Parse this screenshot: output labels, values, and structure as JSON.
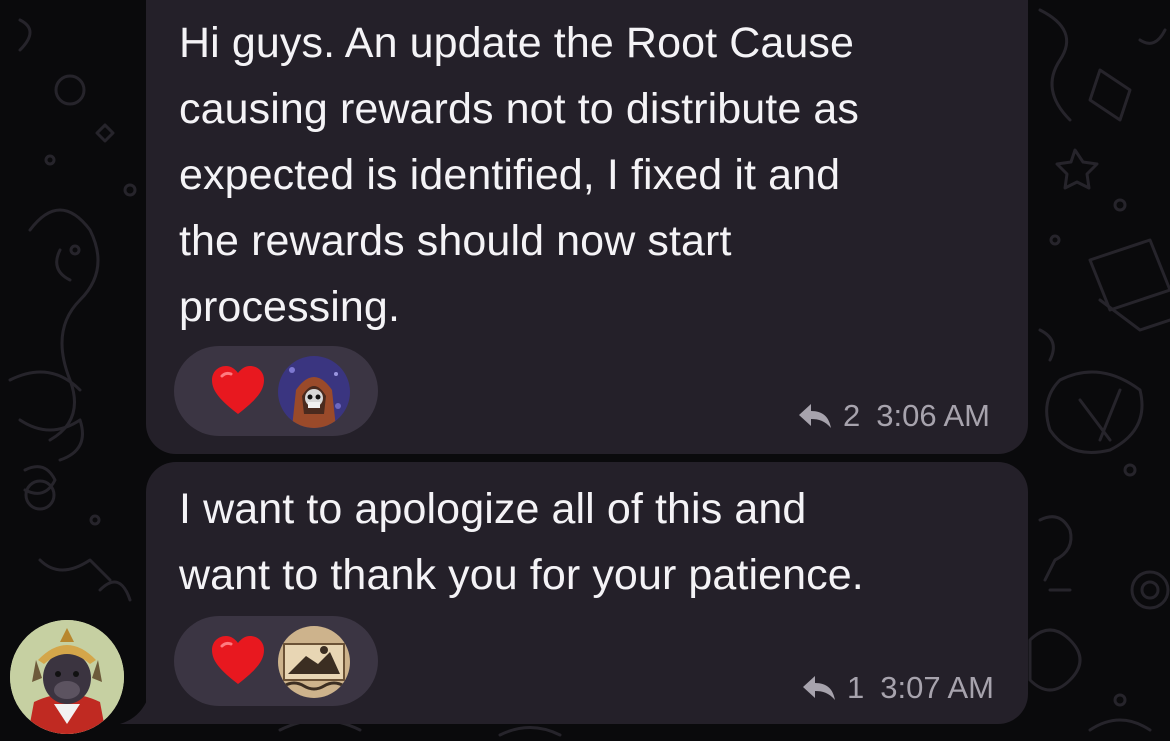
{
  "messages": [
    {
      "text": "Hi guys. An update the Root Cause\ncausing rewards not to distribute as\nexpected is identified, I fixed it and\nthe rewards should now start\nprocessing.",
      "reaction_icon": "heart-icon",
      "reply_count": "2",
      "time": "3:06 AM"
    },
    {
      "text": "I want to apologize all of this and\nwant to thank you for your patience.",
      "reaction_icon": "heart-icon",
      "reply_count": "1",
      "time": "3:07 AM"
    }
  ],
  "colors": {
    "bubble": "#242029",
    "reaction_pill": "#3b3543",
    "heart": "#e8181f",
    "meta_text": "#a7a3ad",
    "message_text": "#f4f3f6"
  }
}
